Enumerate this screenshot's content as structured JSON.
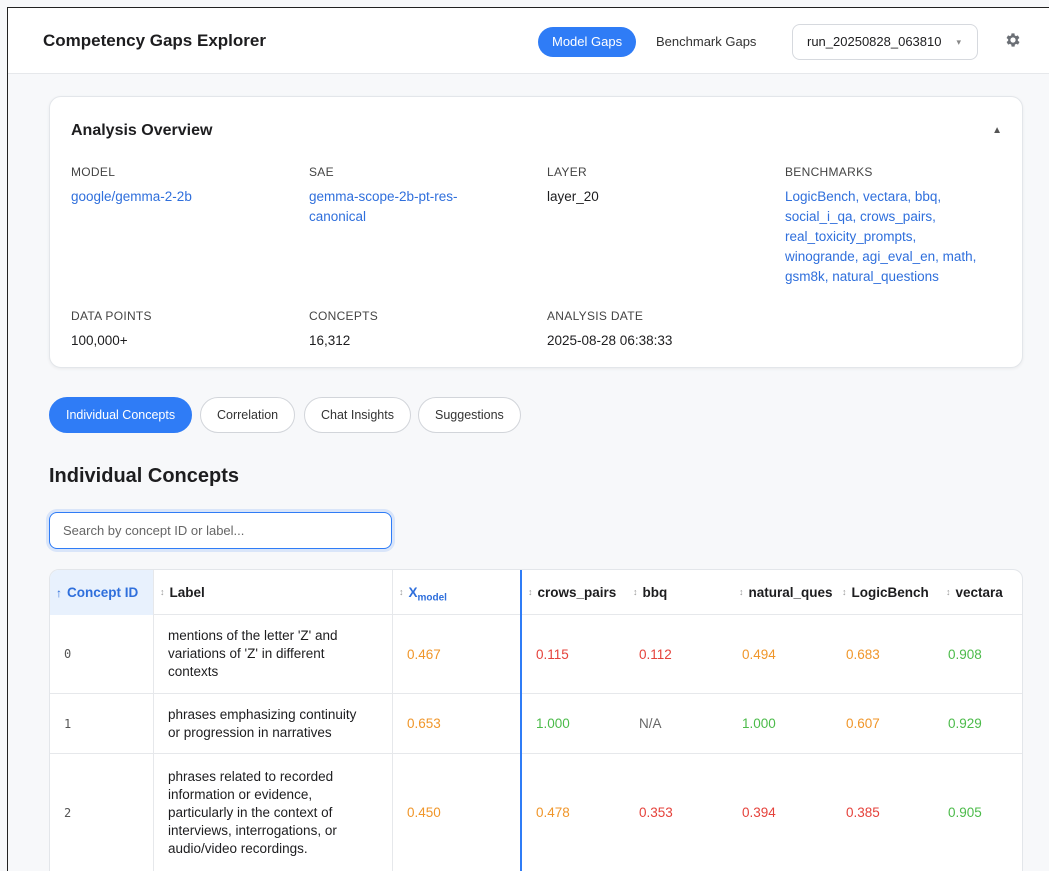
{
  "app": {
    "title": "Competency Gaps Explorer"
  },
  "nav": {
    "model_gaps": "Model Gaps",
    "benchmark_gaps": "Benchmark Gaps",
    "run": "run_20250828_063810"
  },
  "overview": {
    "title": "Analysis Overview",
    "model": {
      "label": "MODEL",
      "value": "google/gemma-2-2b"
    },
    "sae": {
      "label": "SAE",
      "value_line1": "gemma-scope-2b-pt-res-",
      "value_line2": "canonical"
    },
    "layer": {
      "label": "LAYER",
      "value": "layer_20"
    },
    "benchmarks": {
      "label": "BENCHMARKS",
      "line1": "LogicBench, vectara, bbq,",
      "line2": "social_i_qa, crows_pairs,",
      "line3": "real_toxicity_prompts,",
      "line4": "winogrande, agi_eval_en, math,",
      "line5": "gsm8k, natural_questions"
    },
    "data_points": {
      "label": "DATA POINTS",
      "value": "100,000+"
    },
    "concepts": {
      "label": "CONCEPTS",
      "value": "16,312"
    },
    "analysis_date": {
      "label": "ANALYSIS DATE",
      "value": "2025-08-28 06:38:33"
    }
  },
  "tabs": [
    "Individual Concepts",
    "Correlation",
    "Chat Insights",
    "Suggestions"
  ],
  "section": {
    "title": "Individual Concepts",
    "search_placeholder": "Search by concept ID or label..."
  },
  "table": {
    "headers": {
      "concept_id": "Concept ID",
      "label": "Label",
      "x": "X",
      "x_sub": "model",
      "crows_pairs": "crows_pairs",
      "bbq": "bbq",
      "natural_questions": "natural_ques",
      "logicbench": "LogicBench",
      "vectara": "vectara"
    },
    "rows": [
      {
        "id": "0",
        "label": [
          "mentions of the letter 'Z' and",
          "variations of 'Z' in different",
          "contexts"
        ],
        "x": "0.467",
        "crows_pairs": "0.115",
        "bbq": "0.112",
        "natural_questions": "0.494",
        "logicbench": "0.683",
        "vectara": "0.908"
      },
      {
        "id": "1",
        "label": [
          "phrases emphasizing continuity",
          "or progression in narratives"
        ],
        "x": "0.653",
        "crows_pairs": "1.000",
        "bbq": "N/A",
        "natural_questions": "1.000",
        "logicbench": "0.607",
        "vectara": "0.929"
      },
      {
        "id": "2",
        "label": [
          "phrases related to recorded",
          "information or evidence,",
          "particularly in the context of",
          "interviews, interrogations, or",
          "audio/video recordings."
        ],
        "x": "0.450",
        "crows_pairs": "0.478",
        "bbq": "0.353",
        "natural_questions": "0.394",
        "logicbench": "0.385",
        "vectara": "0.905"
      }
    ]
  },
  "colors": {
    "accent": "#2f7cf6",
    "orange": "#f0962a",
    "red": "#e5423b",
    "green": "#4cbb4a"
  }
}
